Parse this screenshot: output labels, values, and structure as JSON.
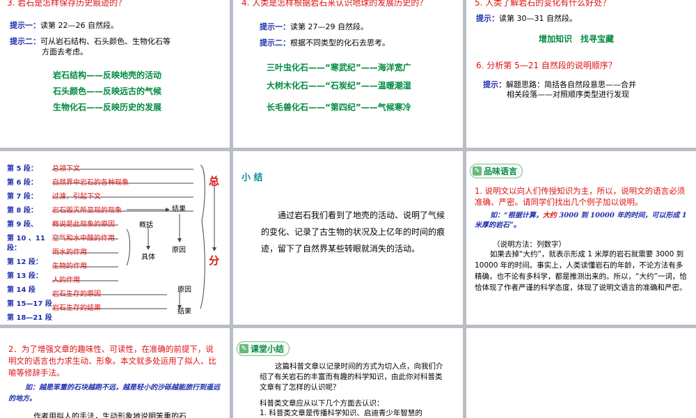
{
  "s1": {
    "q": "3. 岩石是怎样保存历史痕迹的？",
    "h1_label": "提示一：",
    "h1_text": "读第 22—26 自然段。",
    "h2_label": "提示二：",
    "h2_text": "可从岩石结构、石头颜色、生物化石等",
    "h2_cont": "方面去考虑。",
    "l1": "岩石结构——反映地壳的活动",
    "l2": "石头颜色——反映远古的气候",
    "l3": "生物化石——反映历史的发展"
  },
  "s2": {
    "q": "4. 人类是怎样根据岩石来认识地球的发展历史的？",
    "h1_label": "提示一：",
    "h1_text": "读第 27—29 自然段。",
    "h2_label": "提示二：",
    "h2_text": "根据不同类型的化石去思考。",
    "l1": "三叶虫化石——“寒武纪”——海洋宽广",
    "l2": "大树木化石——“石炭纪”——温暖潮湿",
    "l3": "长毛兽化石——“第四纪”——气候寒冷"
  },
  "s3": {
    "q5": "5. 人类了解岩石的变化有什么好处？",
    "h_label": "提示：",
    "h_text": "读第 30—31 自然段。",
    "ans": "增加知识　找寻宝藏",
    "q6": "6. 分析第 5—21 自然段的说明顺序？",
    "t_label": "提示：",
    "t1": "解题思路：简括各自然段意思——合并",
    "t2": "相关段落——对照顺序类型进行发现"
  },
  "s4": {
    "items": [
      {
        "p": "第 5 段：",
        "c": "总领下文"
      },
      {
        "p": "第 6 段：",
        "c": "自然界中岩石的各种现象"
      },
      {
        "p": "第 7 段：",
        "c": "过渡，引起下文"
      },
      {
        "p": "第 8 段：",
        "c": "岩石毁灭所显现的现象"
      },
      {
        "p": "第 9 段、",
        "c": "概说是此现象的原因"
      },
      {
        "p": "第 10 、11",
        "c": "空气和水中酸的作用"
      },
      {
        "p": "段：",
        "c": "雨水的作用"
      },
      {
        "p": "第 12 段：",
        "c": "生物的作用"
      },
      {
        "p": "第 13 段：",
        "c": "人的作用"
      },
      {
        "p": "第 14 段",
        "c": "岩石生存的原因"
      },
      {
        "p": "第 15—17 段",
        "c": "岩石生存的结果"
      },
      {
        "p": "第 18—21 段",
        "c": ""
      }
    ],
    "zong": "总",
    "fen": "分",
    "jieguo1": "结果",
    "gaikuo": "概括",
    "juti": "具体",
    "yuanyin1": "原因",
    "yuanyin2": "原因",
    "jieguo2": "结果"
  },
  "s5": {
    "title": "小 结",
    "body": "通过岩石我们看到了地壳的活动、说明了气候的变化、记录了古生物的状况及上亿年的时间的痕迹，留下了自然界某些转眼就消失的活动。"
  },
  "s6": {
    "chip": "品味语言",
    "p1": "1. 说明文以向人们传授知识为主，所以，说明文的语言必须准确、严密。请同学们找出几个例子加以说明。",
    "ex_a": "如：“根据计算，",
    "ex_b": "大约",
    "ex_c": " 3000 到 10000 年的时间，可以形成 1 米厚的岩石”。",
    "method": "（说明方法：列数字）",
    "body": "如果去掉“大约”，就表示形成 1 米厚的岩石就需要 3000 到 10000 年的时间。事实上，人类读懂岩石的年龄，不论方法有多精确，也不论有多科学，都是推测出来的。所以，“大约”一词，恰恰体现了作者严谨的科学态度，体现了说明文语言的准确和严密。"
  },
  "s7": {
    "p": "2．为了增强文章的趣味性、可读性，在准确的前提下，说明文的语言也力求生动、形象。本文就多处运用了拟人、比喻等修辞手法。",
    "ex": "如：越是笨重的石块越跑不远，越是轻小的沙砾越能旅行到遥远的地方。",
    "body": "作者用拟人的手法，生动形象地说明笨重的石"
  },
  "s8": {
    "chip": "课堂小结",
    "p1": "这篇科普文章以记录时间的方式为切入点，向我们介绍了有关岩石的丰富而有趣的科学知识，由此你对科普类文章有了怎样的认识呢？",
    "p2": "科普类文章应从以下几个方面去认识：",
    "p3": "1. 科普类文章是传播科学知识、启迪青少年智慧的"
  }
}
